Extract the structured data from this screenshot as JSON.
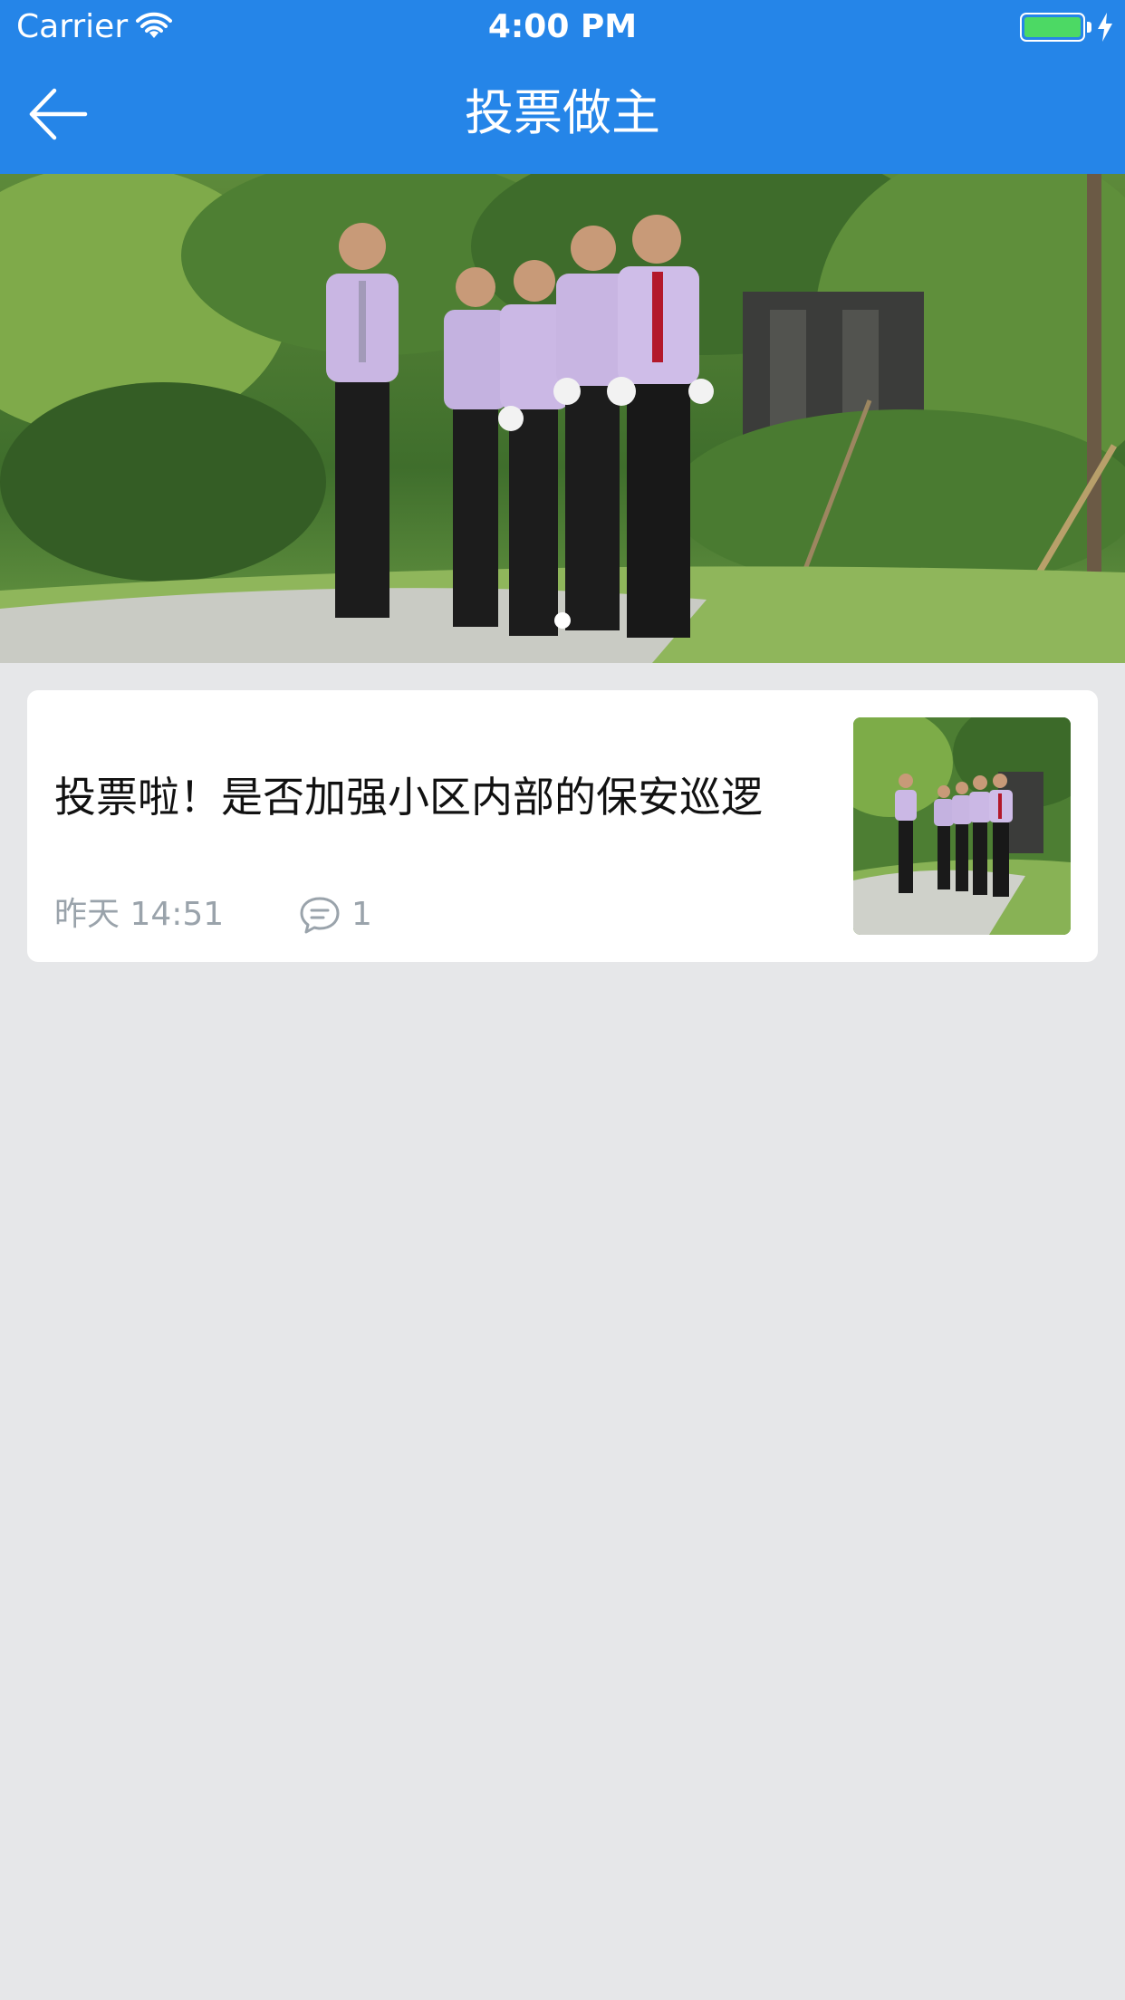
{
  "status_bar": {
    "carrier": "Carrier",
    "time": "4:00 PM",
    "battery_color": "#4cd964"
  },
  "nav": {
    "title": "投票做主",
    "back_icon": "back-arrow-icon",
    "background": "#2585e8"
  },
  "banner": {
    "image": "security-guards-walking-photo",
    "page_count": 1,
    "current_page": 1
  },
  "posts": [
    {
      "title": "投票啦！是否加强小区内部的保安巡逻",
      "time": "昨天 14:51",
      "comment_icon": "comment-icon",
      "comments": "1",
      "thumbnail": "security-guards-walking-photo"
    }
  ]
}
